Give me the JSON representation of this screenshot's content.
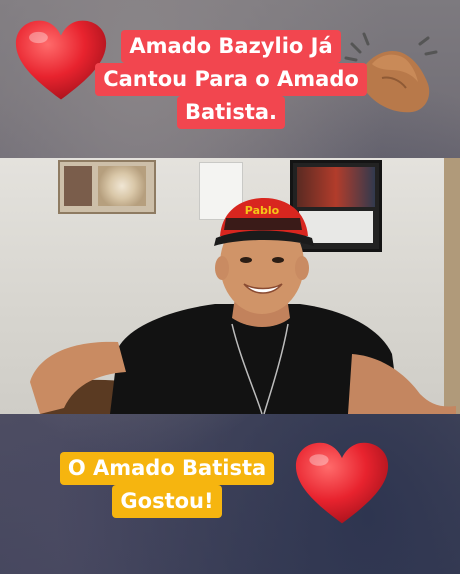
{
  "caption_top": {
    "lines": [
      "Amado Bazylio Já",
      "Cantou Para o Amado",
      "Batista."
    ]
  },
  "caption_bottom": {
    "lines": [
      "O Amado Batista",
      "Gostou!"
    ]
  },
  "cap_text": "Pablo",
  "colors": {
    "top_caption_bg": "#f2464f",
    "bottom_caption_bg": "#f6b50f",
    "heart": "#e8232e"
  }
}
